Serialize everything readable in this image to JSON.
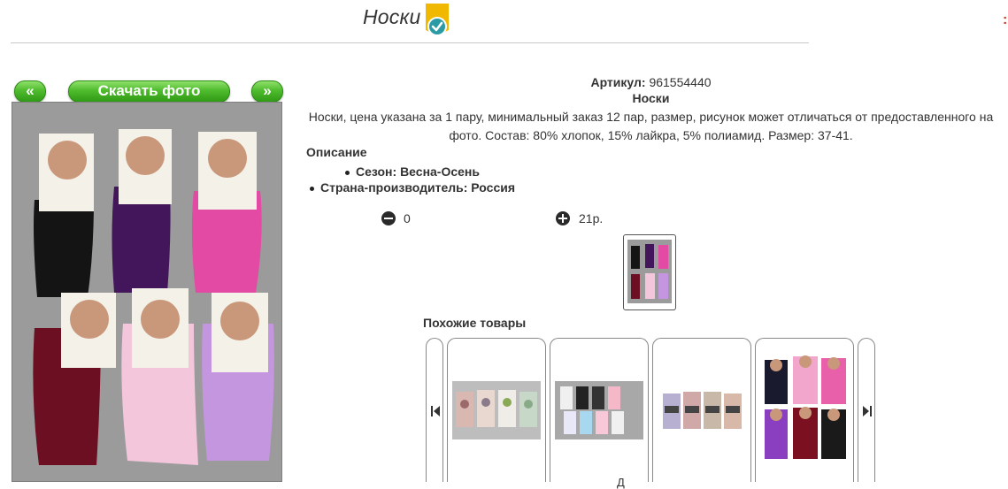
{
  "header": {
    "title": "Носки",
    "badge_icon": "verified-check-icon",
    "accent_color": "#2a9aa5",
    "badge_color": "#f0b800"
  },
  "gallery": {
    "prev_label": "«",
    "download_label": "Скачать фото",
    "next_label": "»",
    "button_color": "#4fbb2d"
  },
  "product": {
    "article_label": "Артикул:",
    "article_value": "961554440",
    "name": "Носки",
    "description": "Носки, цена указана за 1 пару, минимальный заказ 12 пар, размер, рисунок может отличаться от предоставленного на фото. Состав: 80% хлопок, 15% лайкра, 5% полиамид. Размер: 37-41.",
    "details_title": "Описание",
    "details": [
      "Сезон: Весна-Осень",
      "Страна-производитель: Россия"
    ],
    "quantity": "0",
    "price": "21р."
  },
  "similar": {
    "title": "Похожие товары",
    "prev_icon": "arrow-left-icon",
    "next_icon": "arrow-right-icon"
  },
  "footer_fragment": "Д"
}
